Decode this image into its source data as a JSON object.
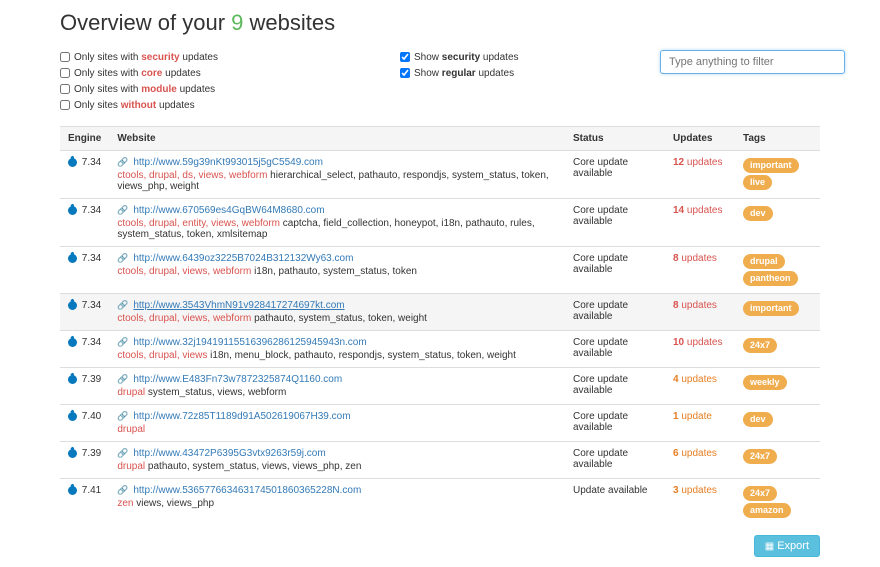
{
  "header": {
    "prefix": "Overview of your ",
    "count": "9",
    "suffix": " websites"
  },
  "filters": {
    "only_security": {
      "label_pre": "Only sites with ",
      "bold": "security",
      "label_post": " updates",
      "checked": false
    },
    "only_core": {
      "label_pre": "Only sites with ",
      "bold": "core",
      "label_post": " updates",
      "checked": false
    },
    "only_module": {
      "label_pre": "Only sites with ",
      "bold": "module",
      "label_post": " updates",
      "checked": false
    },
    "only_without": {
      "label_pre": "Only sites ",
      "bold": "without",
      "label_post": " updates",
      "checked": false
    },
    "show_security": {
      "label_pre": "Show ",
      "bold": "security",
      "label_post": " updates",
      "checked": true
    },
    "show_regular": {
      "label_pre": "Show ",
      "bold": "regular",
      "label_post": " updates",
      "checked": true
    },
    "search_placeholder": "Type anything to filter"
  },
  "columns": {
    "engine": "Engine",
    "website": "Website",
    "status": "Status",
    "updates": "Updates",
    "tags": "Tags"
  },
  "rows": [
    {
      "engine": "7.34",
      "url": "http://www.59g39nKt993015j5gC5549.com",
      "mods_sec": "ctools, drupal, ds, views, webform",
      "mods_reg": " hierarchical_select, pathauto, respondjs, system_status, token, views_php, weight",
      "status": "Core update available",
      "updates_n": "12",
      "updates_w": "updates",
      "upd_class": "upd-red",
      "tags": [
        "important",
        "live"
      ]
    },
    {
      "engine": "7.34",
      "url": "http://www.670569es4GqBW64M8680.com",
      "mods_sec": "ctools, drupal, entity, views, webform",
      "mods_reg": " captcha, field_collection, honeypot, i18n, pathauto, rules, system_status, token, xmlsitemap",
      "status": "Core update available",
      "updates_n": "14",
      "updates_w": "updates",
      "upd_class": "upd-red",
      "tags": [
        "dev"
      ]
    },
    {
      "engine": "7.34",
      "url": "http://www.6439oz3225B7024B312132Wy63.com",
      "mods_sec": "ctools, drupal, views, webform",
      "mods_reg": " i18n, pathauto, system_status, token",
      "status": "Core update available",
      "updates_n": "8",
      "updates_w": "updates",
      "upd_class": "upd-red",
      "tags": [
        "drupal",
        "pantheon"
      ]
    },
    {
      "engine": "7.34",
      "url": "http://www.3543VhmN91v928417274697kt.com",
      "mods_sec": "ctools, drupal, views, webform",
      "mods_reg": " pathauto, system_status, token, weight",
      "status": "Core update available",
      "updates_n": "8",
      "updates_w": "updates",
      "upd_class": "upd-red",
      "tags": [
        "important"
      ],
      "highlight": true,
      "cursor": true
    },
    {
      "engine": "7.34",
      "url": "http://www.32j19419115516396286125945943n.com",
      "mods_sec": "ctools, drupal, views",
      "mods_reg": " i18n, menu_block, pathauto, respondjs, system_status, token, weight",
      "status": "Core update available",
      "updates_n": "10",
      "updates_w": "updates",
      "upd_class": "upd-red",
      "tags": [
        "24x7"
      ]
    },
    {
      "engine": "7.39",
      "url": "http://www.E483Fn73w7872325874Q1160.com",
      "mods_sec": "drupal",
      "mods_reg": " system_status, views, webform",
      "status": "Core update available",
      "updates_n": "4",
      "updates_w": "updates",
      "upd_class": "upd-orange",
      "tags": [
        "weekly"
      ]
    },
    {
      "engine": "7.40",
      "url": "http://www.72z85T1189d91A502619067H39.com",
      "mods_sec": "drupal",
      "mods_reg": "",
      "status": "Core update available",
      "updates_n": "1",
      "updates_w": "update",
      "upd_class": "upd-orange",
      "tags": [
        "dev"
      ]
    },
    {
      "engine": "7.39",
      "url": "http://www.43472P6395G3vtx9263r59j.com",
      "mods_sec": "drupal",
      "mods_reg": " pathauto, system_status, views, views_php, zen",
      "status": "Core update available",
      "updates_n": "6",
      "updates_w": "updates",
      "upd_class": "upd-orange",
      "tags": [
        "24x7"
      ]
    },
    {
      "engine": "7.41",
      "url": "http://www.536577663463174501860365228N.com",
      "mods_sec": "zen",
      "mods_reg": " views, views_php",
      "status": "Update available",
      "updates_n": "3",
      "updates_w": "updates",
      "upd_class": "upd-orange",
      "tags": [
        "24x7",
        "amazon"
      ]
    }
  ],
  "export_label": "Export"
}
